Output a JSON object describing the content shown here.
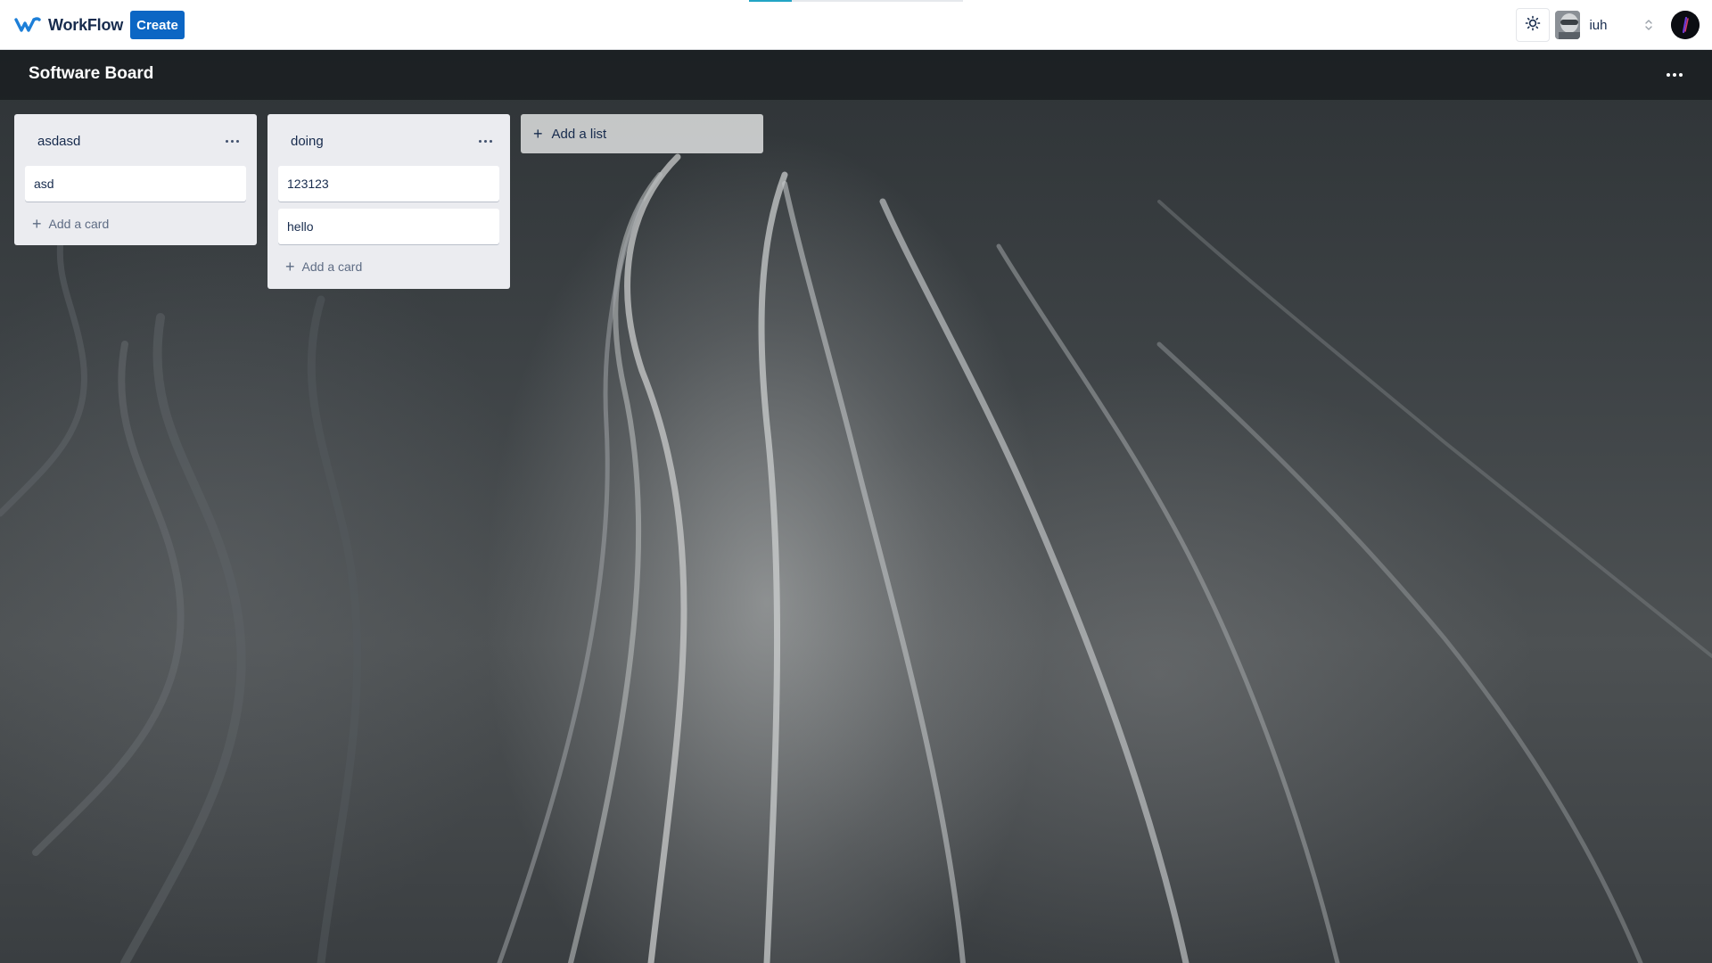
{
  "app": {
    "brand_name": "WorkFlow",
    "create_label": "Create",
    "workspace_name": "iuh",
    "accent_color": "#0c66c4"
  },
  "board": {
    "title": "Software Board"
  },
  "lists": [
    {
      "title": "asdasd",
      "cards": [
        "asd"
      ],
      "add_card_label": "Add a card"
    },
    {
      "title": "doing",
      "cards": [
        "123123",
        "hello"
      ],
      "add_card_label": "Add a card"
    }
  ],
  "add_list_label": "Add a list",
  "icons": {
    "brand": "workflow-logo-icon",
    "theme": "sun-icon",
    "list_menu": "more-horizontal-icon",
    "board_menu": "more-horizontal-icon",
    "add": "plus-icon",
    "switcher": "chevron-up-down-icon"
  }
}
